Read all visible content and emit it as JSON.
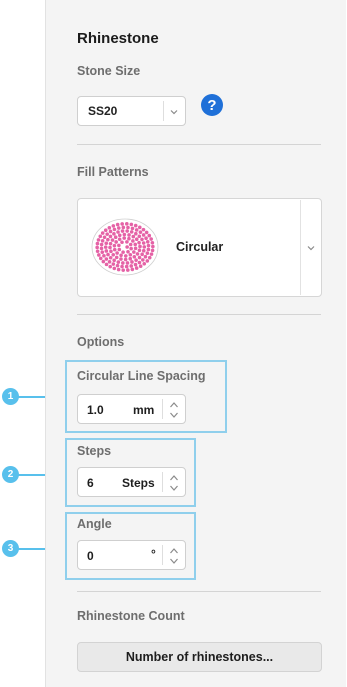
{
  "panel": {
    "title": "Rhinestone",
    "stone_size": {
      "label": "Stone Size",
      "value": "SS20",
      "help_glyph": "?"
    },
    "fill_patterns": {
      "label": "Fill Patterns",
      "selected": "Circular"
    },
    "options": {
      "label": "Options",
      "circular_line_spacing": {
        "label": "Circular Line Spacing",
        "value": "1.0",
        "unit": "mm"
      },
      "steps": {
        "label": "Steps",
        "value": "6",
        "unit": "Steps"
      },
      "angle": {
        "label": "Angle",
        "value": "0",
        "unit": "°"
      }
    },
    "rhinestone_count": {
      "label": "Rhinestone Count",
      "button_label": "Number of rhinestones..."
    }
  },
  "callouts": [
    "1",
    "2",
    "3"
  ],
  "colors": {
    "accent": "#1f70d8",
    "callout": "#58c0ec",
    "highlight_border": "#8fcfec",
    "stone_dot": "#e562a6"
  },
  "icons": {
    "help": "help-circle-icon",
    "dropdown": "chevron-down-icon",
    "spinner": "spin-up-down-icon",
    "pattern_preview": "circular-pattern-icon"
  }
}
